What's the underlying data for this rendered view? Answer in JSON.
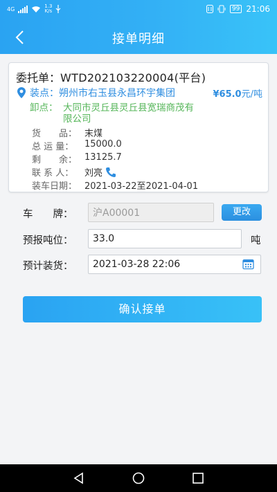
{
  "status": {
    "network": "4G",
    "speed_value": "1.3",
    "speed_unit": "K/s",
    "battery": "99",
    "time": "21:06"
  },
  "header": {
    "title": "接单明细"
  },
  "order": {
    "label": "委托单：",
    "code": "WTD202103220004(平台)",
    "load_label": "装点：",
    "load_place": "朔州市右玉县永昌环宇集团",
    "price": "¥65.0",
    "price_unit": "元/吨",
    "unload_label": "卸点：",
    "unload_place": "大同市灵丘县灵丘县宽瑞商茂有限公司",
    "fields": [
      {
        "key": "货　　品：",
        "value": "末煤"
      },
      {
        "key": "总 运 量：",
        "value": "15000.0"
      },
      {
        "key": "剩　　余：",
        "value": "13125.7"
      },
      {
        "key": "联 系 人：",
        "value": "刘亮"
      },
      {
        "key": "装车日期：",
        "value": "2021-03-22至2021-04-01"
      }
    ]
  },
  "form": {
    "plate_label": "车　　牌：",
    "plate_value": "沪A00001",
    "change_label": "更改",
    "tonnage_label": "预报吨位：",
    "tonnage_value": "33.0",
    "tonnage_unit": "吨",
    "loading_label": "预计装货：",
    "loading_value": "2021-03-28 22:06"
  },
  "confirm_label": "确认接单",
  "colors": {
    "accent": "#2aa3f2",
    "load": "#2f8ee0",
    "unload": "#56b65a"
  }
}
